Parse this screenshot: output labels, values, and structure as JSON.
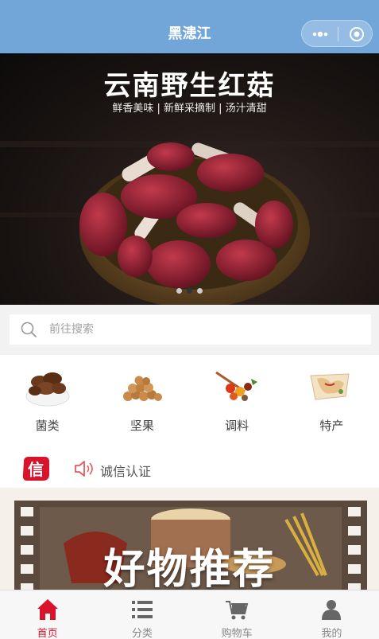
{
  "navbar": {
    "title": "黑漶江",
    "more_icon": "more-dots-icon",
    "close_icon": "target-circle-icon"
  },
  "banner": {
    "headline": "云南野生红菇",
    "subline": "鲜香美味 | 新鲜采摘制 | 汤汁清甜",
    "slide_count": 3,
    "active_slide": 2
  },
  "search": {
    "placeholder": "前往搜索",
    "icon": "search-icon"
  },
  "categories": [
    {
      "label": "菌类",
      "icon": "mushroom-bowl-icon"
    },
    {
      "label": "坚果",
      "icon": "nuts-pile-icon"
    },
    {
      "label": "调料",
      "icon": "spices-icon"
    },
    {
      "label": "特产",
      "icon": "specialty-food-icon"
    }
  ],
  "notice": {
    "seal_text": "信",
    "speaker_icon": "speaker-icon",
    "text": "诚信认证"
  },
  "promo": {
    "title": "好物推荐"
  },
  "tabbar": [
    {
      "label": "首页",
      "icon": "home-icon",
      "active": true
    },
    {
      "label": "分类",
      "icon": "list-icon",
      "active": false
    },
    {
      "label": "购物车",
      "icon": "cart-icon",
      "active": false
    },
    {
      "label": "我的",
      "icon": "user-icon",
      "active": false
    }
  ],
  "colors": {
    "navbar": "#72a6d8",
    "accent": "#d8142c",
    "tab_inactive": "#888888"
  }
}
